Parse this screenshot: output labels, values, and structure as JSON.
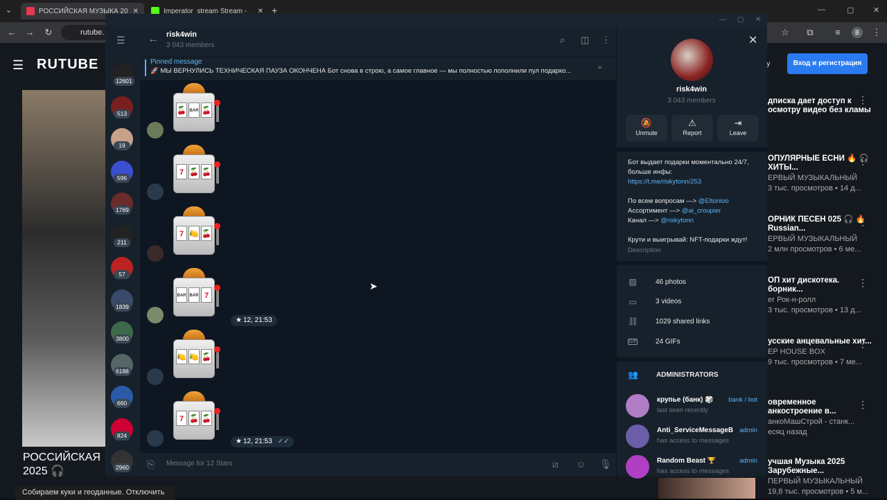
{
  "browser": {
    "tabs": [
      {
        "title": "РОССИЙСКАЯ МУЗЫКА 20"
      },
      {
        "title": "Imperator_stream Stream -"
      }
    ],
    "url": "rutube."
  },
  "rutube": {
    "logo": "RUTUBE",
    "login_button": "Вход и регистрация",
    "login_partial": "у",
    "video_title": "РОССИЙСКАЯ 2025 🎧",
    "cookie_text": "Собираем куки и геоданные. Отключить",
    "side_items": [
      {
        "title": "дписка дает доступ к осмотру видео без кламы",
        "sub": ""
      },
      {
        "title": "ОПУЛЯРНЫЕ ЕСНИ 🔥 🎧 ХИТЫ...",
        "sub": "ЕРВЫЙ МУЗЫКАЛЬНЫЙ",
        "meta": "3 тыс. просмотров • 14 д..."
      },
      {
        "title": "ОРНИК ПЕСЕН 025 🎧 🔥 Russian...",
        "sub": "ЕРВЫЙ МУЗЫКАЛЬНЫЙ",
        "meta": "2 млн просмотров • 6 ме..."
      },
      {
        "title": "ОП хит дискотека. борник...",
        "sub": "ег Рок-н-ролл",
        "meta": "3 тыс. просмотров • 13 д..."
      },
      {
        "title": "усские анцевальные хит...",
        "sub": "EP HOUSE BOX",
        "meta": "9 тыс. просмотров • 7 ме..."
      },
      {
        "title": "овременное анкостроение в...",
        "sub": "анкоМашСтрой - станк...",
        "meta": "есяц назад"
      },
      {
        "title": "учшая Музыка 2025 Зарубежные...",
        "sub": "ПЕРВЫЙ МУЗЫКАЛЬНЫЙ",
        "meta": "19,8 тыс. просмотров • 5 м..."
      }
    ]
  },
  "telegram": {
    "chat": {
      "title": "risk4win",
      "members": "3 043 members"
    },
    "pinned": {
      "label": "Pinned message",
      "text": "🚀 МЫ ВЕРНУЛИСЬ ТЕХНИЧЕСКАЯ ПАУЗА ОКОНЧЕНА  Бот снова в строю, а самое главное — мы полностью пополнили пул подарко..."
    },
    "chat_list_badges": [
      "12601",
      "513",
      "19",
      "596",
      "1769",
      "211",
      "57",
      "1839",
      "3800",
      "6188",
      "660",
      "824",
      "2960"
    ],
    "messages": [
      {
        "reels": [
          "cherry",
          "bar",
          "cherry"
        ],
        "time": ""
      },
      {
        "reels": [
          "7",
          "cherry",
          "cherry"
        ],
        "time": ""
      },
      {
        "reels": [
          "7",
          "lemon",
          "cherry"
        ],
        "time": ""
      },
      {
        "reels": [
          "bar",
          "bar",
          "7"
        ],
        "time": "12, 21:53"
      },
      {
        "reels": [
          "lemon",
          "lemon",
          "cherry"
        ],
        "time": ""
      },
      {
        "reels": [
          "7",
          "cherry",
          "cherry"
        ],
        "time": "12, 21:53"
      }
    ],
    "composer_placeholder": "Message for 12 Stars",
    "info": {
      "name": "risk4win",
      "members": "3 043 members",
      "actions": {
        "unmute": "Unmute",
        "report": "Report",
        "leave": "Leave"
      },
      "description_lines": [
        {
          "text": "Бот выдает подарки моментально 24/7, больше инфы:"
        },
        {
          "link": "https://t.me/riskytonn/253"
        },
        {
          "text": "По всем вопросам —> ",
          "link": "@Eltonioo"
        },
        {
          "text": "Ассортимент —> ",
          "link": "@ai_croupier"
        },
        {
          "text": "Канал —> ",
          "link": "@riskytonn"
        },
        {
          "text": "Крути и выигрывай: NFT-подарки ждут!"
        }
      ],
      "description_label": "Description",
      "media": [
        {
          "icon": "photo-icon",
          "label": "46 photos"
        },
        {
          "icon": "video-icon",
          "label": "3 videos"
        },
        {
          "icon": "link-icon",
          "label": "1029 shared links"
        },
        {
          "icon": "gif-icon",
          "label": "24 GIFs"
        }
      ],
      "admins_header": "ADMINISTRATORS",
      "admins": [
        {
          "name": "крупье (банк) 🎲",
          "status": "last seen recently",
          "role": "bank / bot",
          "color": "#b07cc6"
        },
        {
          "name": "Anti_ServiceMessageB...",
          "status": "has access to messages",
          "role": "admin",
          "color": "#6a5fa8"
        },
        {
          "name": "Random Beast 🏆",
          "status": "has access to messages",
          "role": "admin",
          "color": "#b03fc4"
        }
      ]
    }
  }
}
